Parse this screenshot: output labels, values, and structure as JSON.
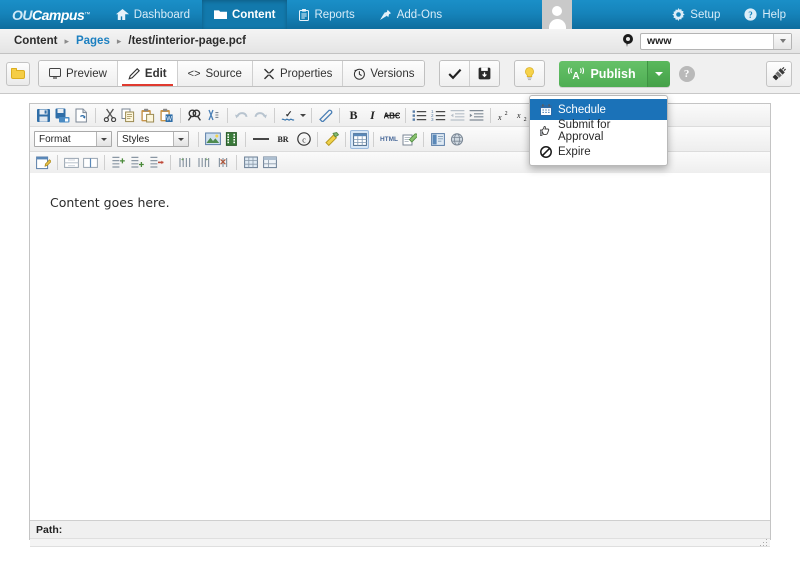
{
  "topnav": {
    "logo_text": "Campus",
    "logo_prefix": "OU",
    "items": [
      {
        "label": "Dashboard",
        "icon": "home-icon",
        "active": false
      },
      {
        "label": "Content",
        "icon": "folder-icon",
        "active": true
      },
      {
        "label": "Reports",
        "icon": "clipboard-icon",
        "active": false
      },
      {
        "label": "Add-Ons",
        "icon": "pin-icon",
        "active": false
      }
    ],
    "right_items": [
      {
        "label": "Setup",
        "icon": "gear-icon"
      },
      {
        "label": "Help",
        "icon": "help-circle-icon"
      }
    ],
    "avatar_name": "user-avatar",
    "bg_color": "#1684bb"
  },
  "breadcrumb": {
    "items": [
      {
        "label": "Content",
        "type": "plain"
      },
      {
        "label": "Pages",
        "type": "link"
      },
      {
        "label": "/test/interior-page.pcf",
        "type": "plain"
      }
    ],
    "separator": "▸",
    "site_selector": {
      "value": "www",
      "icon": "location-pin-icon"
    }
  },
  "actionbar": {
    "folder_button": "folder-icon",
    "tabs": [
      {
        "label": "Preview",
        "icon": "monitor-icon",
        "active": false
      },
      {
        "label": "Edit",
        "icon": "pencil-icon",
        "active": true
      },
      {
        "label": "Source",
        "icon": "code-icon",
        "active": false
      },
      {
        "label": "Properties",
        "icon": "wrench-icon",
        "active": false
      },
      {
        "label": "Versions",
        "icon": "clock-icon",
        "active": false
      }
    ],
    "buttons": [
      {
        "name": "check-button",
        "icon": "check-icon"
      },
      {
        "name": "save-button",
        "icon": "save-box-icon"
      }
    ],
    "lightbulb_button": {
      "name": "lightbulb-button",
      "icon": "lightbulb-icon"
    },
    "publish": {
      "label": "Publish",
      "icon": "broadcast-a-icon",
      "color": "#5cb85c"
    },
    "help_icon": "help-circle-icon",
    "gadget_button": {
      "name": "gadgets-button",
      "icon": "plug-icon"
    }
  },
  "dropdown": {
    "items": [
      {
        "label": "Schedule",
        "icon": "calendar-icon",
        "selected": true
      },
      {
        "label": "Submit for Approval",
        "icon": "hand-thumb-icon",
        "selected": false
      },
      {
        "label": "Expire",
        "icon": "no-entry-icon",
        "selected": false
      }
    ],
    "highlight_color": "#1b72b8"
  },
  "editor": {
    "toolbar_row1": [
      {
        "name": "save-icon",
        "sep": false
      },
      {
        "name": "save-all-icon",
        "sep": false
      },
      {
        "name": "new-page-icon",
        "sep": true
      },
      {
        "name": "cut-icon",
        "sep": false
      },
      {
        "name": "copy-icon",
        "sep": false
      },
      {
        "name": "paste-icon",
        "sep": false
      },
      {
        "name": "paste-from-word-icon",
        "sep": true
      },
      {
        "name": "find-icon",
        "sep": false
      },
      {
        "name": "replace-icon",
        "sep": true
      },
      {
        "name": "undo-icon",
        "sep": false
      },
      {
        "name": "redo-icon",
        "sep": true
      },
      {
        "name": "spellcheck-icon",
        "sep": false
      },
      {
        "name": "spellcheck-dropdown-icon",
        "sep": true
      },
      {
        "name": "remove-format-icon",
        "sep": true
      },
      {
        "name": "bold-icon",
        "sep": false
      },
      {
        "name": "italic-icon",
        "sep": false
      },
      {
        "name": "strikethrough-icon",
        "sep": true
      },
      {
        "name": "bulleted-list-icon",
        "sep": false
      },
      {
        "name": "numbered-list-icon",
        "sep": false
      },
      {
        "name": "outdent-icon",
        "sep": false
      },
      {
        "name": "indent-icon",
        "sep": true
      },
      {
        "name": "superscript-icon",
        "sep": false
      },
      {
        "name": "subscript-icon",
        "sep": true
      },
      {
        "name": "align-left-icon",
        "sep": false
      },
      {
        "name": "align-center-icon",
        "sep": false
      }
    ],
    "format_select": {
      "value": "Format",
      "name": "format-select"
    },
    "styles_select": {
      "value": "Styles",
      "name": "styles-select"
    },
    "toolbar_row2": [
      {
        "name": "image-icon",
        "sep": false
      },
      {
        "name": "media-icon",
        "sep": true
      },
      {
        "name": "horizontal-rule-icon",
        "sep": false
      },
      {
        "name": "line-break-icon",
        "sep": false
      },
      {
        "name": "special-character-icon",
        "sep": true
      },
      {
        "name": "paint-format-icon",
        "sep": true
      },
      {
        "name": "table-icon",
        "sep": true,
        "active": true
      },
      {
        "name": "html-source-icon",
        "sep": false
      },
      {
        "name": "insert-snippet-icon",
        "sep": true
      },
      {
        "name": "insert-asset-icon",
        "sep": false
      },
      {
        "name": "page-properties-icon",
        "sep": false
      }
    ],
    "toolbar_row3": [
      {
        "name": "edit-table-icon",
        "sep": true
      },
      {
        "name": "merge-cells-icon",
        "sep": false
      },
      {
        "name": "split-cell-icon",
        "sep": true
      },
      {
        "name": "insert-row-before-icon",
        "sep": false
      },
      {
        "name": "insert-row-after-icon",
        "sep": false
      },
      {
        "name": "delete-row-icon",
        "sep": true
      },
      {
        "name": "insert-column-before-icon",
        "sep": false
      },
      {
        "name": "insert-column-after-icon",
        "sep": false
      },
      {
        "name": "delete-column-icon",
        "sep": true
      },
      {
        "name": "table-properties-icon",
        "sep": false
      },
      {
        "name": "cell-properties-icon",
        "sep": false
      }
    ],
    "content": "Content goes here.",
    "path_label": "Path:"
  }
}
